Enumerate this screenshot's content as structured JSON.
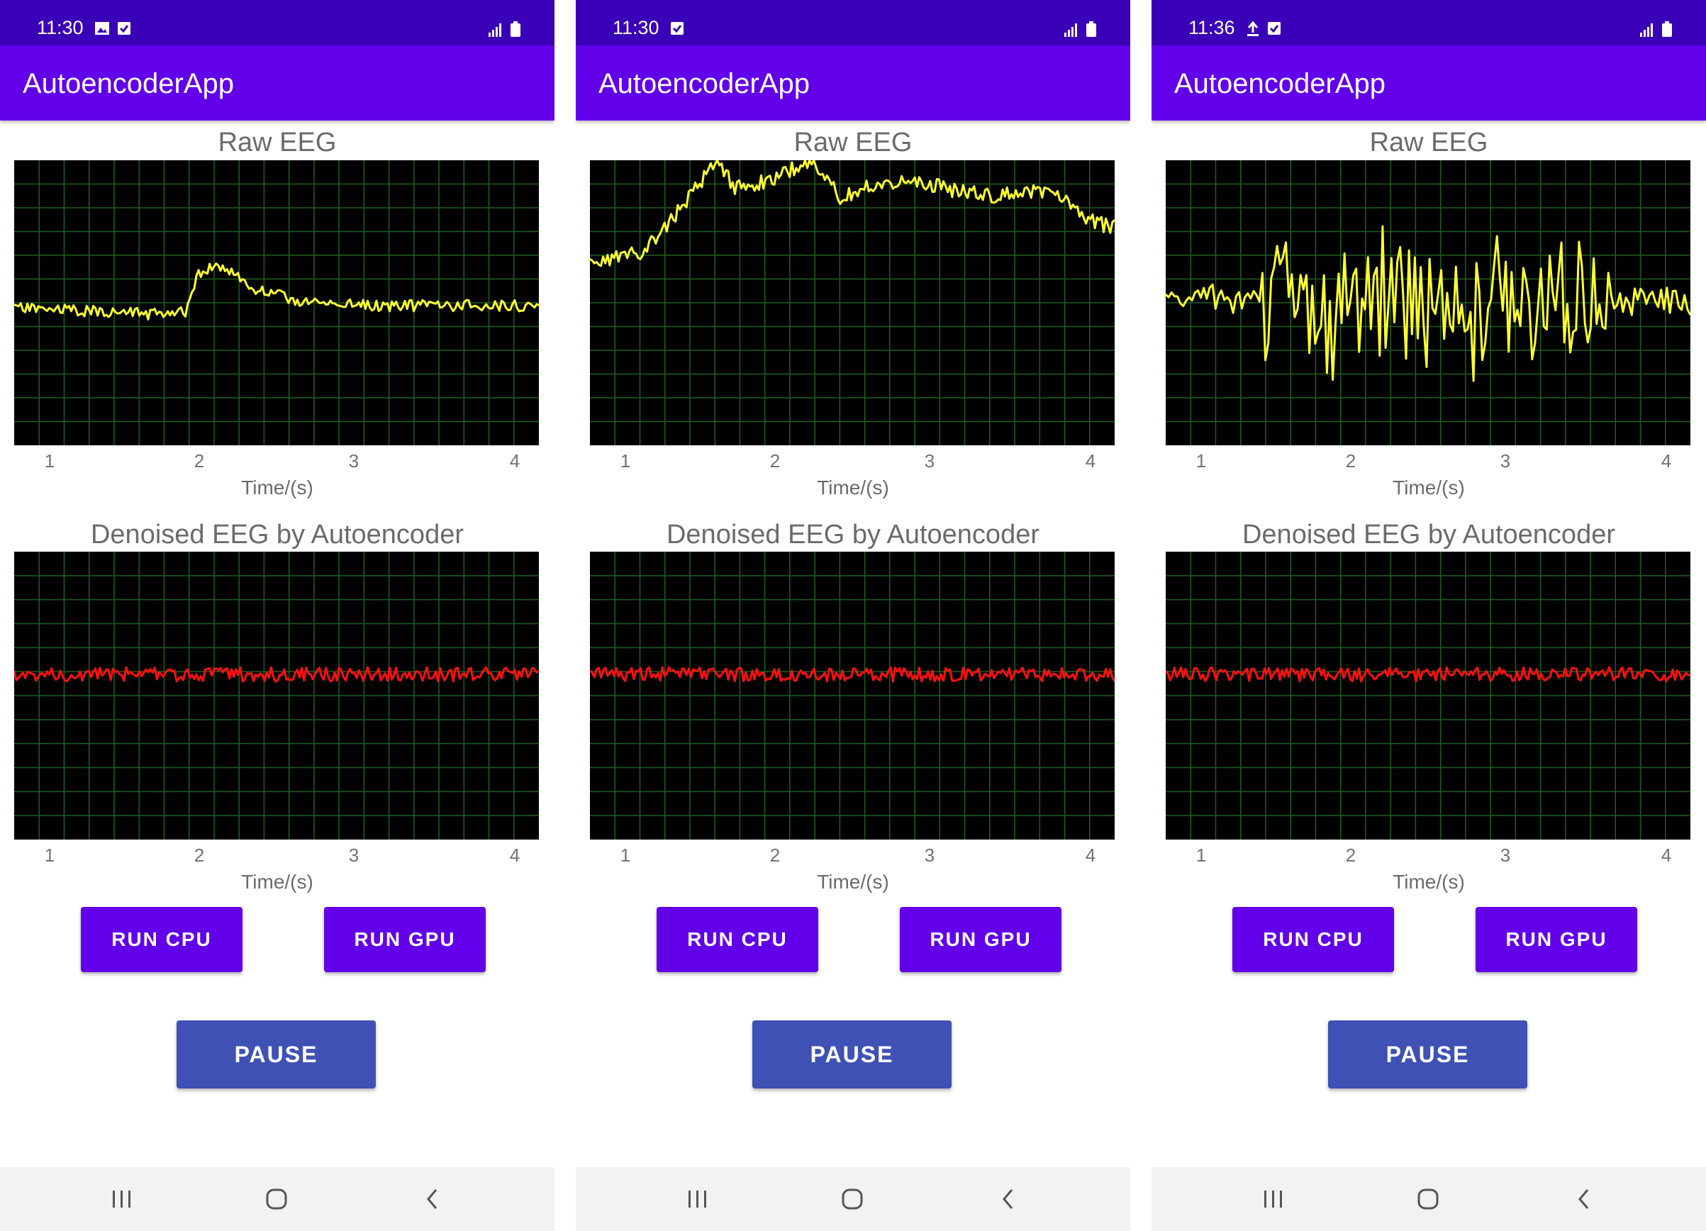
{
  "colors": {
    "status_bar": "#3a00b8",
    "app_bar": "#6200ea",
    "run_button": "#6200ea",
    "pause_button": "#3f51b5",
    "plot_background": "#000000",
    "grid": "#1f5f1f",
    "raw_trace": "#ffff33",
    "denoised_trace": "#ff1010"
  },
  "screens": [
    {
      "status": {
        "time": "11:30",
        "left_icons": [
          "image-icon",
          "check-box-icon"
        ],
        "right_icons": [
          "signal-icon",
          "battery-icon"
        ]
      },
      "app_title": "AutoencoderApp",
      "raw_chart": {
        "title": "Raw EEG",
        "xlabel": "Time/(s)",
        "ticks": [
          "1",
          "2",
          "3",
          "4"
        ]
      },
      "denoised_chart": {
        "title": "Denoised EEG by Autoencoder",
        "xlabel": "Time/(s)",
        "ticks": [
          "1",
          "2",
          "3",
          "4"
        ]
      },
      "buttons": {
        "run_cpu": "RUN CPU",
        "run_gpu": "RUN GPU",
        "pause": "PAUSE"
      },
      "nav": [
        "recent-apps-icon",
        "home-icon",
        "back-icon"
      ]
    },
    {
      "status": {
        "time": "11:30",
        "left_icons": [
          "check-box-icon"
        ],
        "right_icons": [
          "signal-icon",
          "battery-icon"
        ]
      },
      "app_title": "AutoencoderApp",
      "raw_chart": {
        "title": "Raw EEG",
        "xlabel": "Time/(s)",
        "ticks": [
          "1",
          "2",
          "3",
          "4"
        ]
      },
      "denoised_chart": {
        "title": "Denoised EEG by Autoencoder",
        "xlabel": "Time/(s)",
        "ticks": [
          "1",
          "2",
          "3",
          "4"
        ]
      },
      "buttons": {
        "run_cpu": "RUN CPU",
        "run_gpu": "RUN GPU",
        "pause": "PAUSE"
      },
      "nav": [
        "recent-apps-icon",
        "home-icon",
        "back-icon"
      ]
    },
    {
      "status": {
        "time": "11:36",
        "left_icons": [
          "upload-icon",
          "check-box-icon"
        ],
        "right_icons": [
          "signal-icon",
          "battery-icon"
        ]
      },
      "app_title": "AutoencoderApp",
      "raw_chart": {
        "title": "Raw EEG",
        "xlabel": "Time/(s)",
        "ticks": [
          "1",
          "2",
          "3",
          "4"
        ]
      },
      "denoised_chart": {
        "title": "Denoised EEG by Autoencoder",
        "xlabel": "Time/(s)",
        "ticks": [
          "1",
          "2",
          "3",
          "4"
        ]
      },
      "buttons": {
        "run_cpu": "RUN CPU",
        "run_gpu": "RUN GPU",
        "pause": "PAUSE"
      },
      "nav": [
        "recent-apps-icon",
        "home-icon",
        "back-icon"
      ]
    }
  ]
}
